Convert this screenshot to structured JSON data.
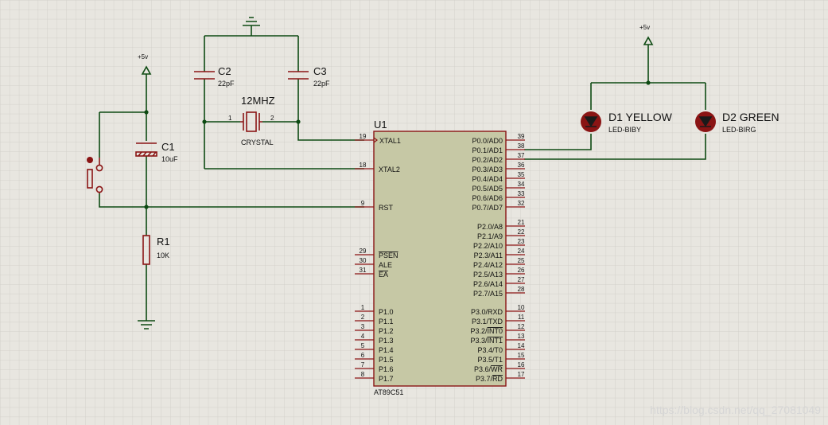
{
  "schematic": {
    "chip": {
      "ref": "U1",
      "part": "AT89C51",
      "left_pins": [
        {
          "num": "19",
          "name": "XTAL1",
          "clk": true
        },
        {
          "num": "18",
          "name": "XTAL2"
        },
        {
          "num": "9",
          "name": "RST"
        },
        {
          "num": "29",
          "name": "PSEN",
          "over": true
        },
        {
          "num": "30",
          "name": "ALE"
        },
        {
          "num": "31",
          "name": "EA",
          "over": true
        },
        {
          "num": "1",
          "name": "P1.0"
        },
        {
          "num": "2",
          "name": "P1.1"
        },
        {
          "num": "3",
          "name": "P1.2"
        },
        {
          "num": "4",
          "name": "P1.3"
        },
        {
          "num": "5",
          "name": "P1.4"
        },
        {
          "num": "6",
          "name": "P1.5"
        },
        {
          "num": "7",
          "name": "P1.6"
        },
        {
          "num": "8",
          "name": "P1.7"
        }
      ],
      "right_pins": [
        {
          "num": "39",
          "name": "P0.0/AD0"
        },
        {
          "num": "38",
          "name": "P0.1/AD1"
        },
        {
          "num": "37",
          "name": "P0.2/AD2"
        },
        {
          "num": "36",
          "name": "P0.3/AD3"
        },
        {
          "num": "35",
          "name": "P0.4/AD4"
        },
        {
          "num": "34",
          "name": "P0.5/AD5"
        },
        {
          "num": "33",
          "name": "P0.6/AD6"
        },
        {
          "num": "32",
          "name": "P0.7/AD7"
        },
        {
          "num": "21",
          "name": "P2.0/A8"
        },
        {
          "num": "22",
          "name": "P2.1/A9"
        },
        {
          "num": "23",
          "name": "P2.2/A10"
        },
        {
          "num": "24",
          "name": "P2.3/A11"
        },
        {
          "num": "25",
          "name": "P2.4/A12"
        },
        {
          "num": "26",
          "name": "P2.5/A13"
        },
        {
          "num": "27",
          "name": "P2.6/A14"
        },
        {
          "num": "28",
          "name": "P2.7/A15"
        },
        {
          "num": "10",
          "name": "P3.0/RXD"
        },
        {
          "num": "11",
          "name": "P3.1/TXD"
        },
        {
          "num": "12",
          "name": "P3.2/INT0",
          "over_suffix": "INT0"
        },
        {
          "num": "13",
          "name": "P3.3/INT1",
          "over_suffix": "INT1"
        },
        {
          "num": "14",
          "name": "P3.4/T0"
        },
        {
          "num": "15",
          "name": "P3.5/T1"
        },
        {
          "num": "16",
          "name": "P3.6/WR",
          "over_suffix": "WR"
        },
        {
          "num": "17",
          "name": "P3.7/RD",
          "over_suffix": "RD"
        }
      ]
    },
    "crystal": {
      "ref": "12MHZ",
      "type": "CRYSTAL",
      "pin1": "1",
      "pin2": "2"
    },
    "c2": {
      "ref": "C2",
      "value": "22pF"
    },
    "c3": {
      "ref": "C3",
      "value": "22pF"
    },
    "c1": {
      "ref": "C1",
      "value": "10uF"
    },
    "r1": {
      "ref": "R1",
      "value": "10K"
    },
    "power_left": {
      "label": "+5v"
    },
    "power_right": {
      "label": "+5v"
    },
    "d1": {
      "ref": "D1 YELLOW",
      "part": "LED-BIBY"
    },
    "d2": {
      "ref": "D2 GREEN",
      "part": "LED-BIRG"
    },
    "watermark": "https://blog.csdn.net/qq_27081049"
  },
  "colors": {
    "background": "#e8e6e0",
    "grid": "#cfcdc6",
    "wire": "#0d4a12",
    "component": "#8a1414",
    "chip_fill": "#c6c8a5"
  }
}
